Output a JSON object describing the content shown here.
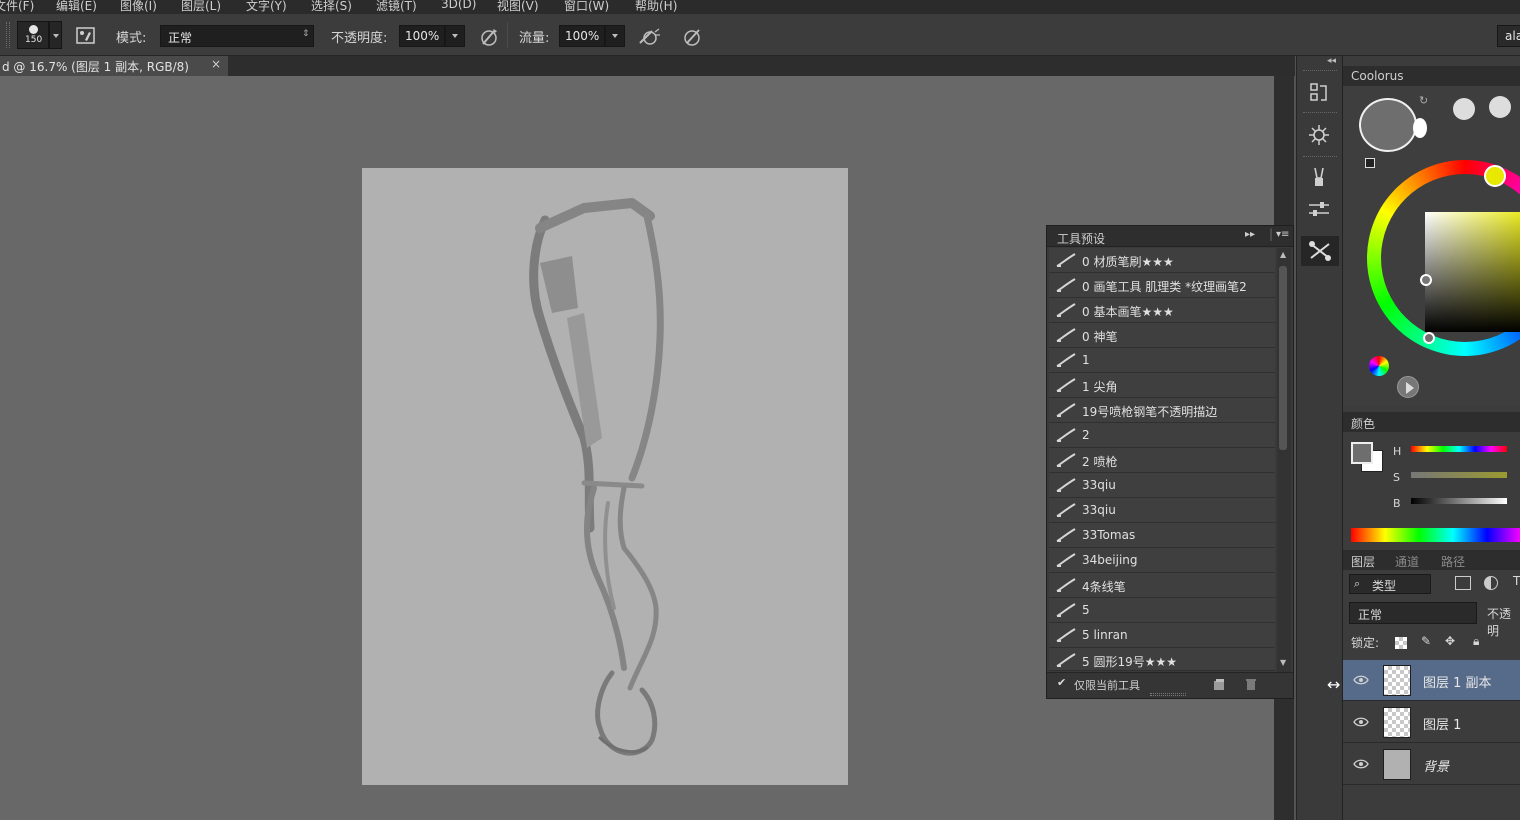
{
  "menu": [
    "文件(F)",
    "编辑(E)",
    "图像(I)",
    "图层(L)",
    "文字(Y)",
    "选择(S)",
    "滤镜(T)",
    "3D(D)",
    "视图(V)",
    "窗口(W)",
    "帮助(H)"
  ],
  "options": {
    "brush_size": "150",
    "mode_label": "模式:",
    "mode_value": "正常",
    "opacity_label": "不透明度:",
    "opacity_value": "100%",
    "flow_label": "流量:",
    "flow_value": "100%",
    "workspace_button": "ala"
  },
  "document": {
    "tab_title": "d @ 16.7% (图层 1 副本, RGB/8)",
    "close": "×",
    "zoom": "16.7%"
  },
  "tool_presets": {
    "title": "工具预设",
    "items": [
      "0 材质笔刷★★★",
      "0 画笔工具 肌理类 *纹理画笔2",
      "0 基本画笔★★★",
      "0 神笔",
      "1",
      "1 尖角",
      "19号喷枪钢笔不透明描边",
      "2",
      "2 喷枪",
      "33qiu",
      "33qiu",
      "33Tomas",
      "34beijing",
      "4条线笔",
      "5",
      "5 linran",
      "5 圆形19号★★★"
    ],
    "current_only_label": "仅限当前工具",
    "current_only_checked": true
  },
  "coolorus": {
    "title": "Coolorus"
  },
  "color_panel": {
    "title": "颜色",
    "h_label": "H",
    "s_label": "S",
    "b_label": "B"
  },
  "layers_panel": {
    "tabs": [
      "图层",
      "通道",
      "路径"
    ],
    "filter_label": "类型",
    "blend_mode": "正常",
    "opacity_label": "不透明",
    "lock_label": "锁定:",
    "layers": [
      {
        "name": "图层 1 副本",
        "selected": true,
        "visible": true
      },
      {
        "name": "图层 1",
        "selected": false,
        "visible": true
      },
      {
        "name": "背景",
        "selected": false,
        "visible": true
      }
    ]
  },
  "colors": {
    "accent_selected_layer": "#566a8a",
    "foreground": "#6e6e6e",
    "background": "#ffffff"
  }
}
